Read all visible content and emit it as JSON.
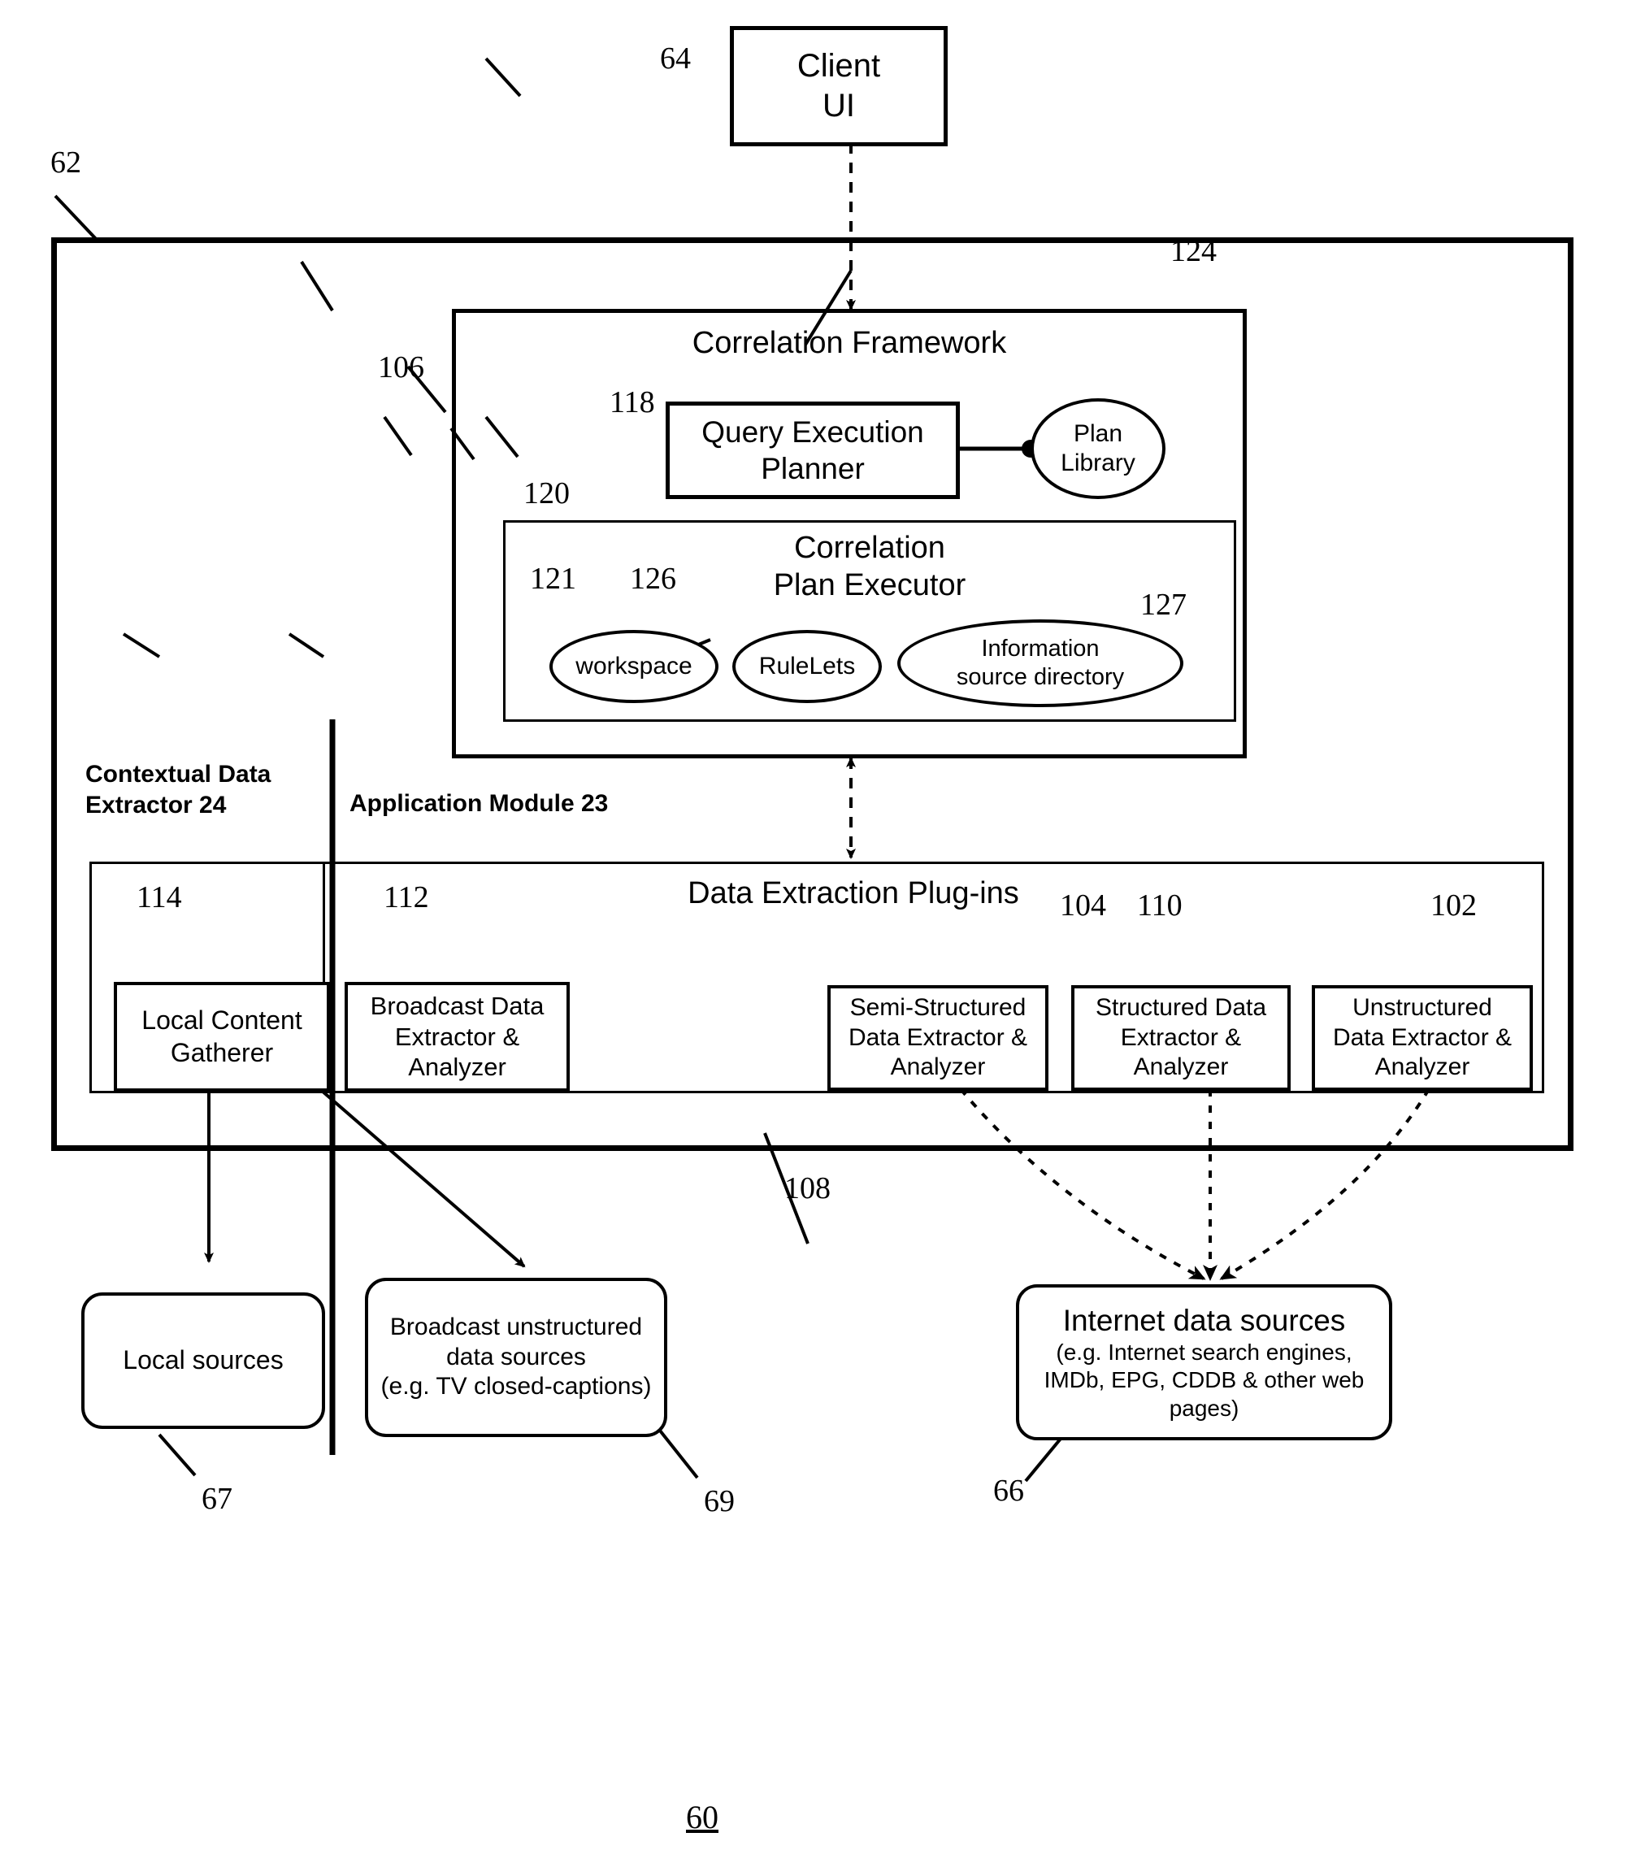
{
  "figure": {
    "number": "60"
  },
  "nodes": {
    "client_ui": {
      "label": "Client\nUI",
      "ref": "64"
    },
    "system_boundary": {
      "ref": "62"
    },
    "correlation_framework": {
      "title": "Correlation Framework",
      "ref": "106"
    },
    "query_execution_planner": {
      "label": "Query Execution\nPlanner",
      "ref": "118"
    },
    "plan_library": {
      "label": "Plan\nLibrary",
      "ref": "124"
    },
    "correlation_plan_executor": {
      "title": "Correlation\nPlan Executor",
      "ref": "120"
    },
    "workspace": {
      "label": "workspace",
      "ref": "121"
    },
    "rulelets": {
      "label": "RuleLets",
      "ref": "126"
    },
    "information_source_directory": {
      "label": "Information\nsource directory",
      "ref": "127"
    },
    "contextual_data_extractor": {
      "label": "Contextual Data\nExtractor 24"
    },
    "application_module": {
      "label": "Application Module 23"
    },
    "data_extraction_plugins": {
      "title": "Data Extraction Plug-ins",
      "ref": "108"
    },
    "local_content_gatherer": {
      "label": "Local Content\nGatherer",
      "ref": "114"
    },
    "broadcast_data_extractor": {
      "label": "Broadcast Data\nExtractor  &\nAnalyzer",
      "ref": "112"
    },
    "semi_structured_extractor": {
      "label": "Semi-Structured\nData Extractor &\nAnalyzer",
      "ref": "104"
    },
    "structured_extractor": {
      "label": "Structured Data\nExtractor &\nAnalyzer",
      "ref": "110"
    },
    "unstructured_extractor": {
      "label": "Unstructured\nData Extractor &\nAnalyzer",
      "ref": "102"
    },
    "local_sources": {
      "label": "Local sources",
      "ref": "67"
    },
    "broadcast_sources": {
      "line1": "Broadcast unstructured",
      "line2": "data sources",
      "line3": "(e.g. TV closed-captions)",
      "ref": "69"
    },
    "internet_sources": {
      "line1": "Internet data sources",
      "line2": "(e.g. Internet search engines,",
      "line3": "IMDb, EPG, CDDB & other web",
      "line4": "pages)",
      "ref": "66"
    }
  },
  "colors": {
    "stroke": "#000000",
    "background": "#ffffff"
  }
}
